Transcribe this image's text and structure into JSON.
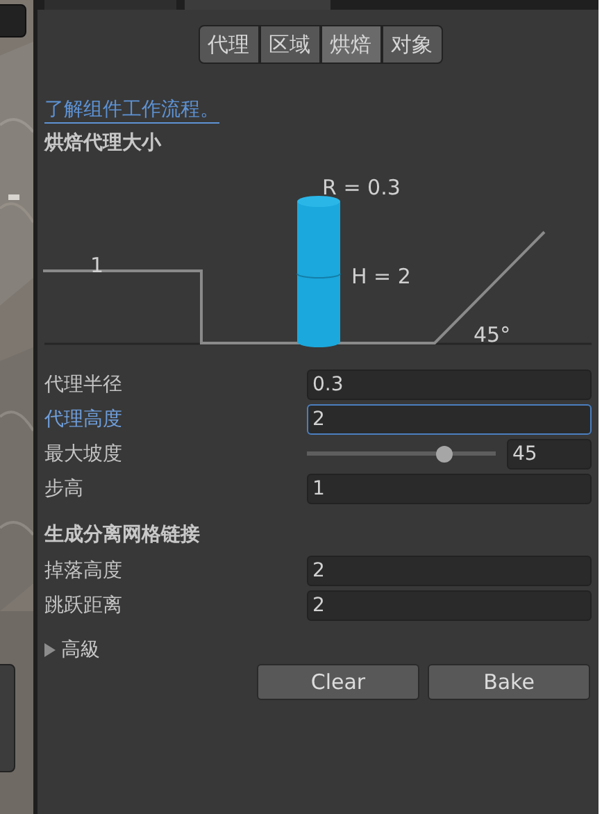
{
  "window_tabs": [
    {
      "selected": false
    },
    {
      "selected": true
    }
  ],
  "tabs": [
    {
      "label": "代理",
      "selected": false
    },
    {
      "label": "区域",
      "selected": false
    },
    {
      "label": "烘焙",
      "selected": true
    },
    {
      "label": "对象",
      "selected": false
    }
  ],
  "help_link": "了解组件工作流程。",
  "agent_section": {
    "title": "烘焙代理大小",
    "diagram": {
      "step_label": "1",
      "radius_label": "R = 0.3",
      "height_label": "H = 2",
      "slope_label": "45°"
    },
    "fields": [
      {
        "kind": "text",
        "label": "代理半径",
        "value": "0.3",
        "focused": false
      },
      {
        "kind": "text",
        "label": "代理高度",
        "value": "2",
        "focused": true
      },
      {
        "kind": "slider",
        "label": "最大坡度",
        "value": "45",
        "level": 0.75,
        "focused": false
      },
      {
        "kind": "text",
        "label": "步高",
        "value": "1",
        "focused": false
      }
    ]
  },
  "offmesh_section": {
    "title": "生成分离网格链接",
    "fields": [
      {
        "kind": "text",
        "label": "掉落高度",
        "value": "2",
        "focused": false
      },
      {
        "kind": "text",
        "label": "跳跃距离",
        "value": "2",
        "focused": false
      }
    ]
  },
  "advanced": {
    "label": "高級",
    "expanded": false
  },
  "buttons": [
    "Clear",
    "Bake"
  ]
}
